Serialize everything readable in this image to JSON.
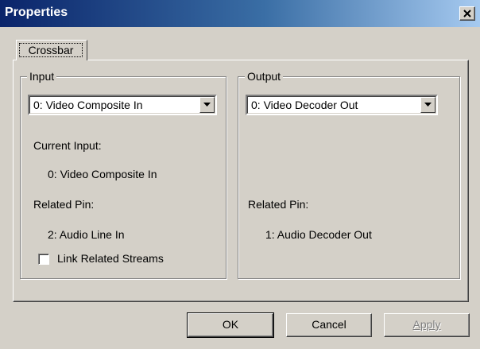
{
  "window": {
    "title": "Properties"
  },
  "tabs": [
    {
      "label": "Crossbar"
    }
  ],
  "input_group": {
    "legend": "Input",
    "select_value": "0: Video Composite In",
    "current_input_label": "Current Input:",
    "current_input_value": "0: Video Composite In",
    "related_pin_label": "Related Pin:",
    "related_pin_value": "2: Audio Line In",
    "link_checkbox_label": "Link Related Streams",
    "link_checked": false
  },
  "output_group": {
    "legend": "Output",
    "select_value": "0: Video Decoder Out",
    "related_pin_label": "Related Pin:",
    "related_pin_value": "1: Audio Decoder Out"
  },
  "buttons": {
    "ok": "OK",
    "cancel": "Cancel",
    "apply": "Apply"
  },
  "colors": {
    "titlebar_start": "#0a246a",
    "titlebar_end": "#a6caf0",
    "face": "#d4d0c8"
  },
  "icons": {
    "close": "close-icon",
    "dropdown": "chevron-down-icon"
  }
}
